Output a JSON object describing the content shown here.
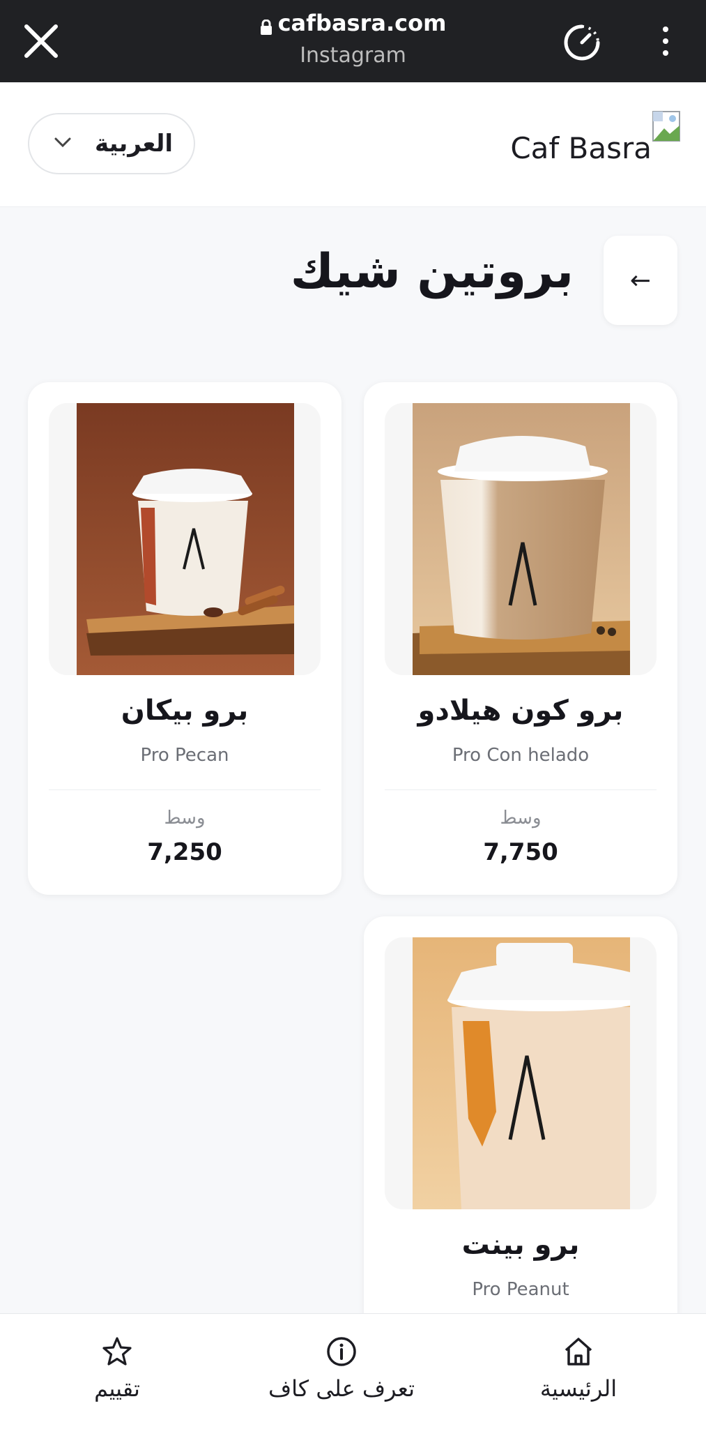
{
  "browser": {
    "url": "cafbasra.com",
    "source": "Instagram"
  },
  "header": {
    "language": "العربية",
    "brand": "Caf Basra"
  },
  "page": {
    "title": "بروتين شيك",
    "back_arrow": "←"
  },
  "products": [
    {
      "name_ar": "برو كون هيلادو",
      "name_en": "Pro Con helado",
      "size": "وسط",
      "price": "7,750",
      "image": "shake-cup-caramel"
    },
    {
      "name_ar": "برو بيكان",
      "name_en": "Pro Pecan",
      "size": "وسط",
      "price": "7,250",
      "image": "shake-cup-pecan"
    },
    {
      "name_ar": "برو بينت",
      "name_en": "Pro Peanut",
      "image": "shake-cup-peanut"
    }
  ],
  "bottom_nav": {
    "home": "الرئيسية",
    "about": "تعرف على كاف",
    "rate": "تقييم"
  },
  "icons": {
    "close": "close-icon",
    "lock": "lock-icon",
    "timer": "timer-icon",
    "more": "kebab-menu-icon",
    "chevron": "chevron-down-icon",
    "home": "home-icon",
    "info": "info-icon",
    "star": "star-icon"
  },
  "colors": {
    "browser_bar": "#202124",
    "background": "#f7f8fa",
    "card": "#ffffff",
    "text": "#1c1c22"
  }
}
